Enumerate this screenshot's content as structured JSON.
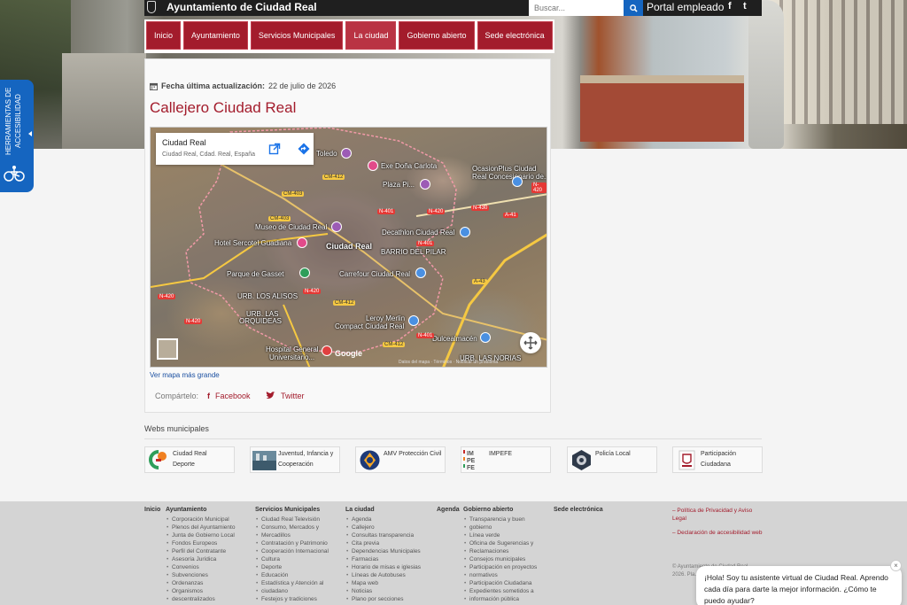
{
  "header": {
    "site_title": "Ayuntamiento de Ciudad Real",
    "search_placeholder": "Buscar...",
    "portal_label": "Portal empleado",
    "facebook_glyph": "f",
    "twitter_glyph": "t"
  },
  "nav": {
    "items": [
      {
        "label": "Inicio",
        "active": false
      },
      {
        "label": "Ayuntamiento",
        "active": false
      },
      {
        "label": "Servicios Municipales",
        "active": false
      },
      {
        "label": "La ciudad",
        "active": true
      },
      {
        "label": "Gobierno abierto",
        "active": false
      },
      {
        "label": "Sede electrónica",
        "active": false
      }
    ]
  },
  "accessibility": {
    "label": "HERRAMIENTAS DE ACCESIBILIDAD",
    "icon": "accessibility-icon"
  },
  "content": {
    "updated_label": "Fecha última actualización:",
    "updated_date": "22 de julio de 2026",
    "page_title": "Callejero Ciudad Real",
    "map_link": "Ver mapa más grande",
    "share_label": "Compártelo:",
    "share_facebook": "Facebook",
    "share_twitter": "Twitter"
  },
  "map": {
    "place_name": "Ciudad Real",
    "place_address": "Ciudad Real, Cdad. Real, España",
    "google_mark": "Google",
    "credits": "Datos del mapa · Términos · Notificar un problema",
    "labels": {
      "toledo": "Toledo",
      "exe": "Exe Doña Carlota",
      "plaza": "Plaza Pi...",
      "ocasion": "OcasionPlus Ciudad",
      "ocasion2": "Real Concesionario de...",
      "museo": "Museo de Ciudad Real",
      "hotel": "Hotel Sercotel Guadiana",
      "city": "Ciudad Real",
      "decathlon": "Decathlon Ciudad Real",
      "barrio": "BARRIO DEL PILAR",
      "parque": "Parque de Gasset",
      "carrefour": "Carrefour Ciudad Real",
      "alisos": "URB. LOS ALISOS",
      "orquideas1": "URB. LAS",
      "orquideas2": "ORQUIDEAS",
      "leroy": "Leroy Merlin",
      "compact": "Compact Ciudad Real",
      "dulce": "Dulcealmacén",
      "hospital1": "Hospital General",
      "hospital2": "Universitario...",
      "norias": "URB. LAS NORIAS"
    },
    "roads": {
      "cm403a": "CM-403",
      "cm412a": "CM-412",
      "n401a": "N-401",
      "n420a": "N-420",
      "cm403b": "CM-403",
      "n430": "N-430",
      "a41": "A-41",
      "n420b": "N-420",
      "n401b": "N-401",
      "n420c": "N-420",
      "a43": "A-43",
      "cm412b": "CM-412",
      "n401c": "N-401",
      "cm412c": "CM-412",
      "n420d": "N-420",
      "n420e": "N-420"
    }
  },
  "webs": {
    "title": "Webs municipales",
    "items": [
      {
        "label1": "Ciudad Real",
        "label2": "Deporte"
      },
      {
        "label1": "Juventud, Infancia y",
        "label2": "Cooperación"
      },
      {
        "label1": "AMV Protección Civil",
        "label2": ""
      },
      {
        "label1": "IMPEFE",
        "label2": ""
      },
      {
        "label1": "Policía Local",
        "label2": ""
      },
      {
        "label1": "Participación",
        "label2": "Ciudadana"
      }
    ],
    "impefe_logo": [
      "IM",
      "PE",
      "FE"
    ]
  },
  "footer": {
    "col_inicio": "Inicio",
    "col_ayuntamiento": {
      "head": "Ayuntamiento",
      "items": [
        "Corporación Municipal",
        "Plenos del Ayuntamiento",
        "Junta de Gobierno Local",
        "Fondos Europeos",
        "Perfil del Contratante",
        "Asesoría Jurídica",
        "Convenios",
        "Subvenciones",
        "Ordenanzas",
        "Organismos",
        "descentralizados"
      ]
    },
    "col_servicios": {
      "head": "Servicios Municipales",
      "items": [
        "Ciudad Real Televisión",
        "Consumo, Mercados y",
        "Mercadillos",
        "Contratación y Patrimonio",
        "Cooperación Internacional",
        "Cultura",
        "Deporte",
        "Educación",
        "Estadística y Atención al",
        "ciudadano",
        "Festejos y tradiciones"
      ]
    },
    "col_ciudad": {
      "head": "La ciudad",
      "items": [
        "Agenda",
        "Callejero",
        "Consultas transparencia",
        "Cita previa",
        "Dependencias Municipales",
        "Farmacias",
        "Horario de misas e iglesias",
        "Líneas de Autobuses",
        "Mapa web",
        "Noticias",
        "Plano por secciones"
      ]
    },
    "col_agenda": "Agenda",
    "col_gobierno": {
      "head": "Gobierno abierto",
      "items": [
        "Transparencia y buen",
        "gobierno",
        "Línea verde",
        "Oficina de Sugerencias y",
        "Reclamaciones",
        "Consejos municipales",
        "Participación en proyectos",
        "normativos",
        "Participación Ciudadana",
        "Expedientes sometidos a",
        "información pública"
      ]
    },
    "col_sede": "Sede electrónica",
    "legal": [
      "– Política de Privacidad y Aviso Legal",
      "– Declaración de accesibilidad web"
    ],
    "copyright": "© Ayuntamiento de Ciudad Real 2026. Pla..."
  },
  "chat": {
    "message": "¡Hola! Soy tu asistente virtual de Ciudad Real. Aprendo cada día para darte la mejor información. ¿Cómo te puedo ayudar?",
    "close": "×"
  },
  "colors": {
    "brand_red": "#a31c2c",
    "accessibility_blue": "#1565c0",
    "link_blue": "#1a4fa0"
  }
}
